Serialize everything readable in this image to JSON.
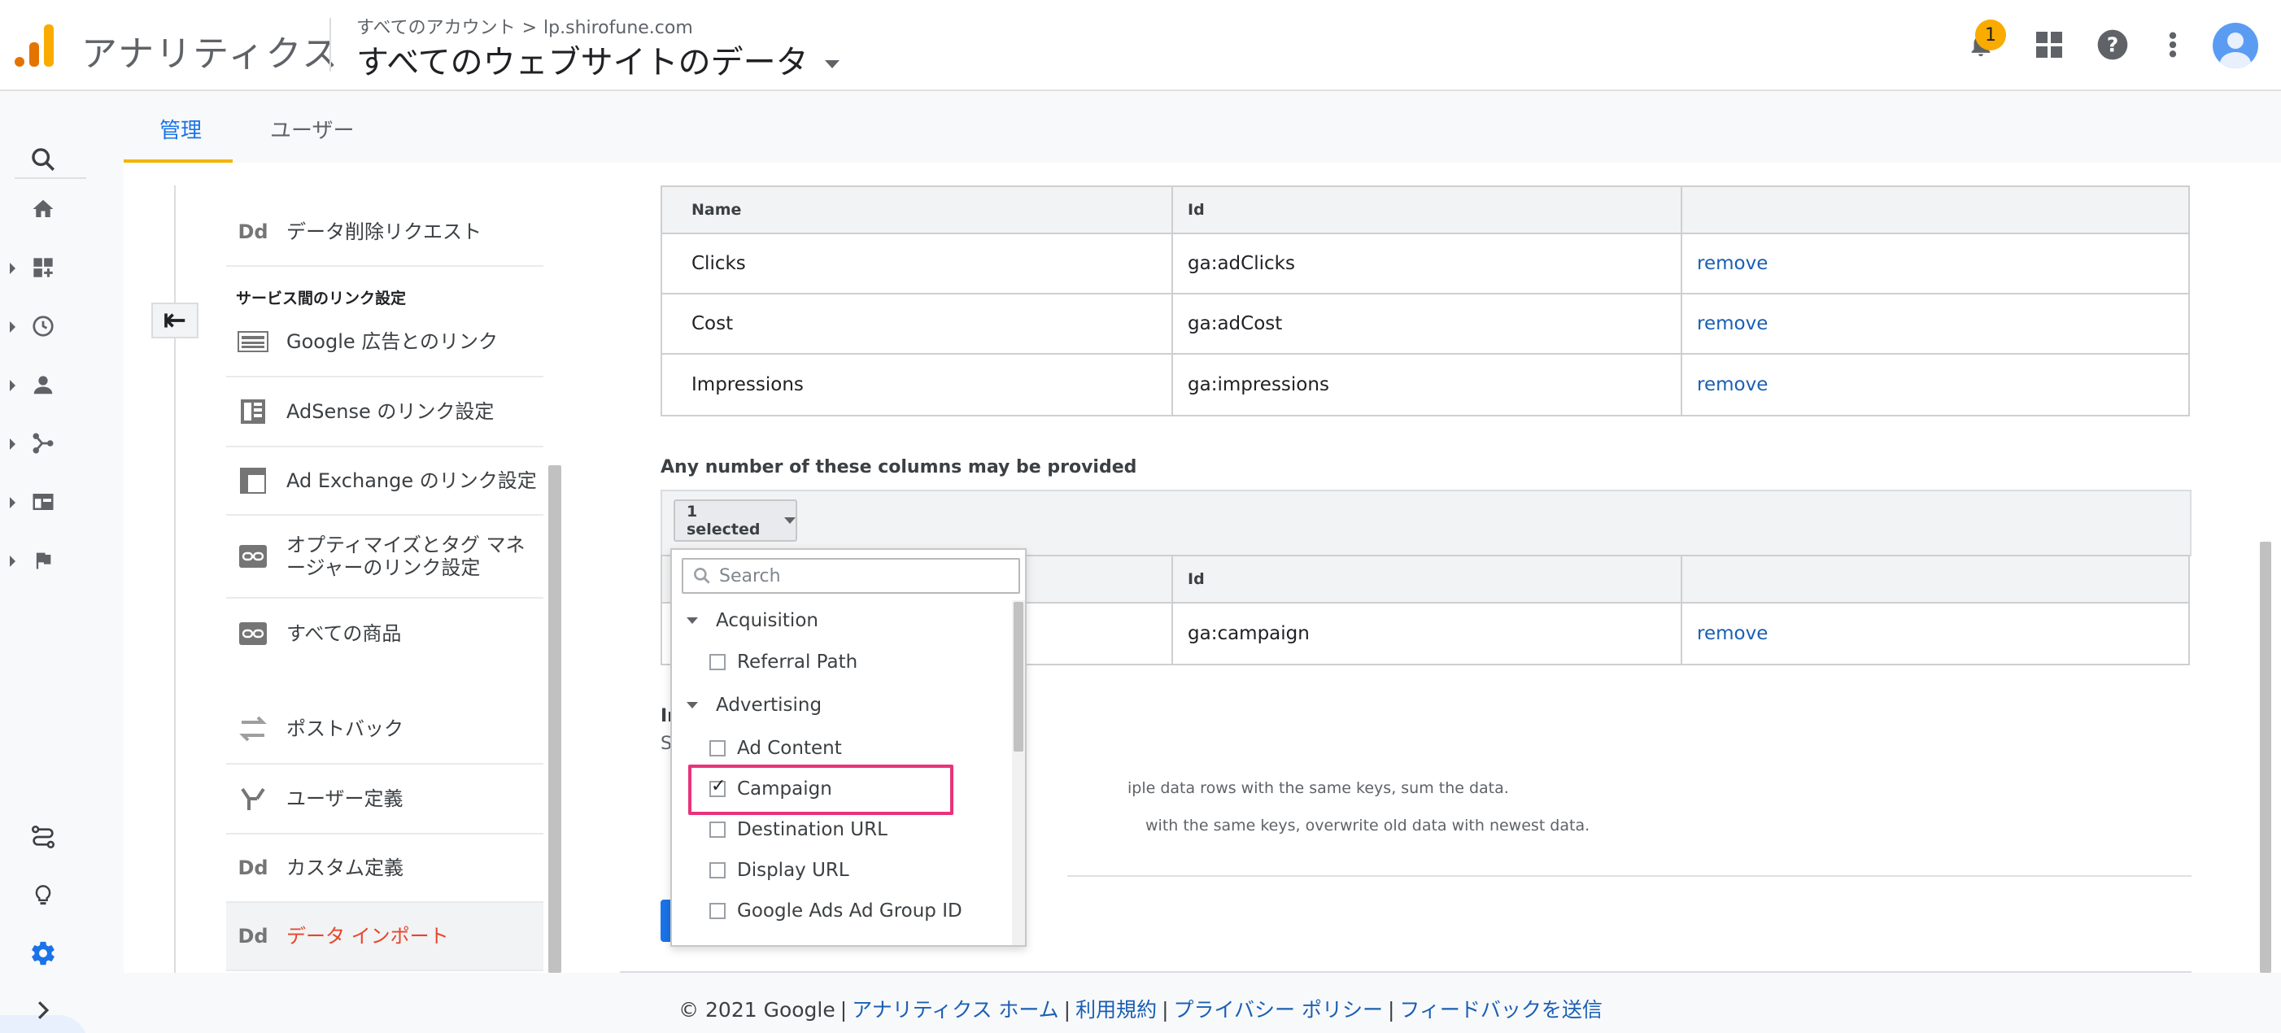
{
  "header": {
    "app_name": "アナリティクス",
    "breadcrumb_account": "すべてのアカウント",
    "breadcrumb_sep": ">",
    "breadcrumb_property": "lp.shirofune.com",
    "view_name": "すべてのウェブサイトのデータ",
    "notification_count": "1",
    "logo_colors": [
      "#f9ab00",
      "#e37400"
    ]
  },
  "tabs": [
    {
      "label": "管理",
      "active": true
    },
    {
      "label": "ユーザー",
      "active": false
    }
  ],
  "left_rail": {
    "icons": [
      "search-icon",
      "home-icon",
      "customization-icon",
      "realtime-icon",
      "audience-icon",
      "acquisition-icon",
      "behavior-icon",
      "conversions-icon",
      "attribution-icon",
      "discover-icon",
      "admin-gear-icon",
      "expand-icon"
    ]
  },
  "admin_nav": {
    "section_heading": "サービス間のリンク設定",
    "items": [
      {
        "icon": "Dd",
        "label": "データ削除リクエスト"
      },
      {
        "icon": "google-ads-icon",
        "label": "Google 広告とのリンク"
      },
      {
        "icon": "adsense-icon",
        "label": "AdSense のリンク設定"
      },
      {
        "icon": "ad-exchange-icon",
        "label": "Ad Exchange のリンク設定"
      },
      {
        "icon": "link-icon",
        "label": "オプティマイズとタグ マネージャーのリンク設定"
      },
      {
        "icon": "link-icon",
        "label": "すべての商品"
      },
      {
        "icon": "postback-icon",
        "label": "ポストバック"
      },
      {
        "icon": "user-definition-icon",
        "label": "ユーザー定義"
      },
      {
        "icon": "Dd",
        "label": "カスタム定義"
      },
      {
        "icon": "Dd",
        "label": "データ インポート",
        "active": true
      }
    ]
  },
  "required_table": {
    "headers": [
      "Name",
      "Id",
      ""
    ],
    "rows": [
      {
        "name": "Clicks",
        "id": "ga:adClicks",
        "action": "remove"
      },
      {
        "name": "Cost",
        "id": "ga:adCost",
        "action": "remove"
      },
      {
        "name": "Impressions",
        "id": "ga:impressions",
        "action": "remove"
      }
    ]
  },
  "optional_columns": {
    "title": "Any number of these columns may be provided",
    "selector_label": "1 selected",
    "table_header_id": "Id",
    "rows": [
      {
        "id": "ga:campaign",
        "action": "remove"
      }
    ]
  },
  "import_behavior": {
    "partial_title": "In",
    "partial_sub": "S",
    "hint_sum": "iple data rows with the same keys, sum the data.",
    "hint_overwrite": "with the same keys, overwrite old data with newest data."
  },
  "dropdown": {
    "search_placeholder": "Search",
    "groups": [
      {
        "label": "Acquisition",
        "options": [
          {
            "label": "Referral Path",
            "checked": false
          }
        ]
      },
      {
        "label": "Advertising",
        "options": [
          {
            "label": "Ad Content",
            "checked": false
          },
          {
            "label": "Campaign",
            "checked": true
          },
          {
            "label": "Destination URL",
            "checked": false
          },
          {
            "label": "Display URL",
            "checked": false
          },
          {
            "label": "Google Ads Ad Group ID",
            "checked": false
          }
        ]
      }
    ]
  },
  "footer": {
    "copyright": "© 2021 Google",
    "sep": "|",
    "links": [
      "アナリティクス ホーム",
      "利用規約",
      "プライバシー ポリシー",
      "フィードバックを送信"
    ]
  },
  "colors": {
    "accent_blue": "#1a73e8",
    "tab_underline": "#f4b400",
    "active_nav_text": "#e8452c",
    "highlight_box": "#e8337a",
    "link_blue": "#1a5fb4"
  }
}
